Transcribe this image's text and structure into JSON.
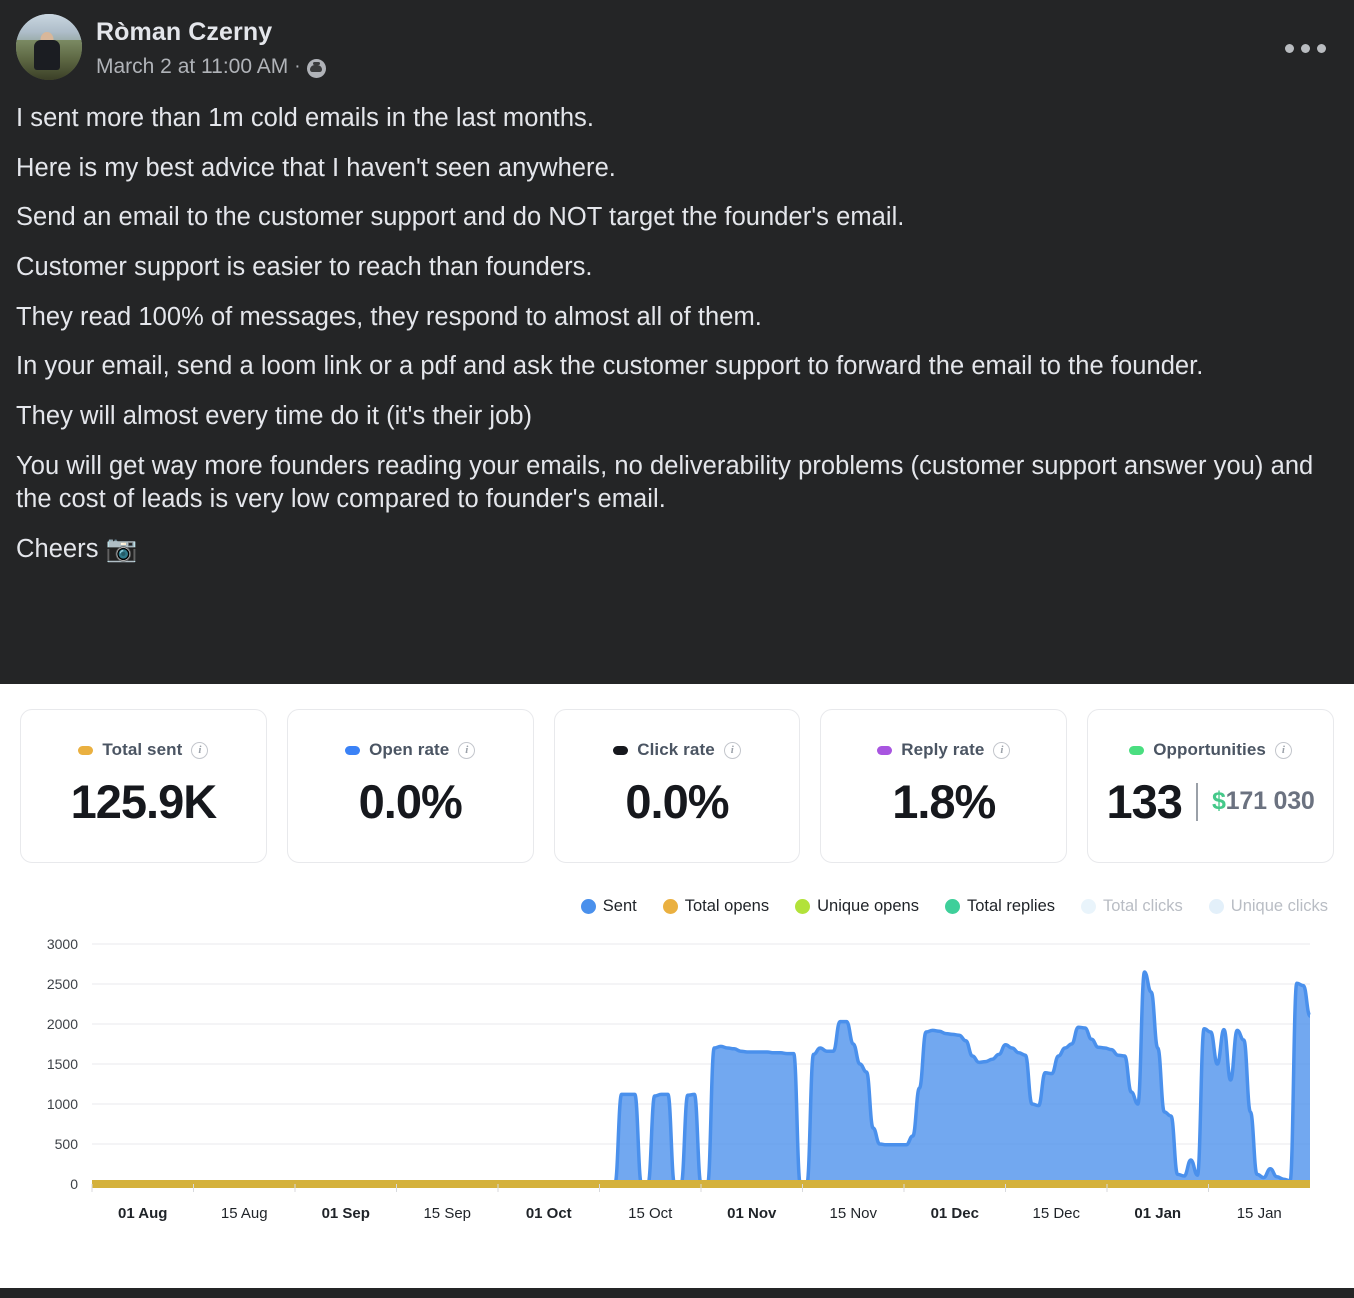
{
  "post": {
    "author": "Ròman Czerny",
    "timestamp": "March 2 at 11:00 AM",
    "meta_separator": "·",
    "audience_icon": "public-audience-icon",
    "more_button_label": "more-options",
    "paragraphs": [
      "I sent more than 1m cold emails in the last months.",
      "Here is my best advice that I haven't seen anywhere.",
      " Send an email to the customer support and do NOT target the founder's email.",
      "Customer support is easier to reach than founders.",
      "They read 100% of messages, they respond to almost all of them.",
      " In your email, send a loom link or a pdf and ask the customer support to forward the email to the founder.",
      "They will almost every time do it (it's their job)",
      "You will get way more founders reading your emails, no deliverability problems (customer support answer you) and the cost of leads is very low compared to founder's email.",
      "Cheers 📷"
    ]
  },
  "dashboard": {
    "cards": [
      {
        "label": "Total sent",
        "value": "125.9K",
        "color": "#eab040",
        "info": "i"
      },
      {
        "label": "Open rate",
        "value": "0.0%",
        "color": "#3b82f6",
        "info": "i"
      },
      {
        "label": "Click rate",
        "value": "0.0%",
        "color": "#16181d",
        "info": "i"
      },
      {
        "label": "Reply rate",
        "value": "1.8%",
        "color": "#a855e0",
        "info": "i"
      },
      {
        "label": "Opportunities",
        "value": "133",
        "color": "#4ade80",
        "info": "i",
        "secondary_currency": "$",
        "secondary_value": "171 030",
        "separator": "|"
      }
    ]
  },
  "chart_data": {
    "type": "area",
    "title": "",
    "xlabel": "",
    "ylabel": "",
    "ylim": [
      0,
      3000
    ],
    "yticks": [
      0,
      500,
      1000,
      1500,
      2000,
      2500,
      3000
    ],
    "grid": true,
    "legend_position": "top-right",
    "xticks": [
      "01 Aug",
      "15 Aug",
      "01 Sep",
      "15 Sep",
      "01 Oct",
      "15 Oct",
      "01 Nov",
      "15 Nov",
      "01 Dec",
      "15 Dec",
      "01 Jan",
      "15 Jan"
    ],
    "xticks_bold": [
      "01 Aug",
      "01 Sep",
      "01 Oct",
      "01 Nov",
      "01 Dec",
      "01 Jan"
    ],
    "legend": [
      {
        "name": "Sent",
        "color": "#4a90ec",
        "active": true
      },
      {
        "name": "Total opens",
        "color": "#eab040",
        "active": true
      },
      {
        "name": "Unique opens",
        "color": "#b9 e23",
        "active": true
      },
      {
        "name": "Total replies",
        "color": "#3ecf9a",
        "active": true
      },
      {
        "name": "Total clicks",
        "color": "#e9f4fb",
        "active": false
      },
      {
        "name": "Unique clicks",
        "color": "#e3f0fa",
        "active": false
      }
    ],
    "series": [
      {
        "name": "Sent",
        "color": "#4a90ec",
        "x_start_label": "15 Oct",
        "values": [
          0,
          0,
          0,
          0,
          0,
          0,
          0,
          0,
          0,
          0,
          0,
          0,
          0,
          0,
          0,
          0,
          0,
          0,
          0,
          0,
          0,
          0,
          0,
          0,
          0,
          0,
          0,
          0,
          0,
          0,
          0,
          0,
          0,
          0,
          0,
          0,
          0,
          0,
          0,
          0,
          0,
          0,
          0,
          0,
          0,
          0,
          0,
          0,
          0,
          0,
          0,
          0,
          0,
          0,
          0,
          0,
          0,
          0,
          0,
          0,
          0,
          0,
          0,
          0,
          0,
          0,
          0,
          0,
          0,
          0,
          0,
          0,
          0,
          0,
          0,
          0,
          0,
          0,
          0,
          0,
          1120,
          1120,
          1120,
          0,
          0,
          1100,
          1120,
          1120,
          0,
          0,
          1110,
          1120,
          0,
          0,
          1700,
          1720,
          1700,
          1690,
          1660,
          1650,
          1650,
          1650,
          1650,
          1640,
          1640,
          1630,
          1630,
          0,
          0,
          1620,
          1700,
          1660,
          1660,
          2030,
          2030,
          1750,
          1500,
          1400,
          700,
          500,
          490,
          490,
          490,
          490,
          600,
          1200,
          1900,
          1920,
          1910,
          1880,
          1870,
          1860,
          1790,
          1600,
          1520,
          1530,
          1560,
          1620,
          1740,
          1700,
          1640,
          1610,
          1000,
          980,
          1390,
          1380,
          1600,
          1700,
          1750,
          1960,
          1950,
          1810,
          1710,
          1700,
          1680,
          1610,
          1600,
          1150,
          1000,
          2650,
          2400,
          1700,
          900,
          850,
          120,
          100,
          300,
          110,
          1940,
          1900,
          1500,
          1930,
          1300,
          1920,
          1800,
          900,
          120,
          80,
          190,
          90,
          60,
          40,
          2510,
          2480,
          2100
        ]
      },
      {
        "name": "Total opens",
        "color": "#d4b13c",
        "values_note": "flat at 0 across full range",
        "values": [
          0
        ]
      },
      {
        "name": "Unique opens",
        "color": "#b2e23a",
        "values_note": "near 0 across range",
        "values": [
          0
        ]
      },
      {
        "name": "Total replies",
        "color": "#3ecf9a",
        "values_note": "near 0, small bumps in Nov-Jan",
        "values": [
          0
        ]
      }
    ]
  }
}
